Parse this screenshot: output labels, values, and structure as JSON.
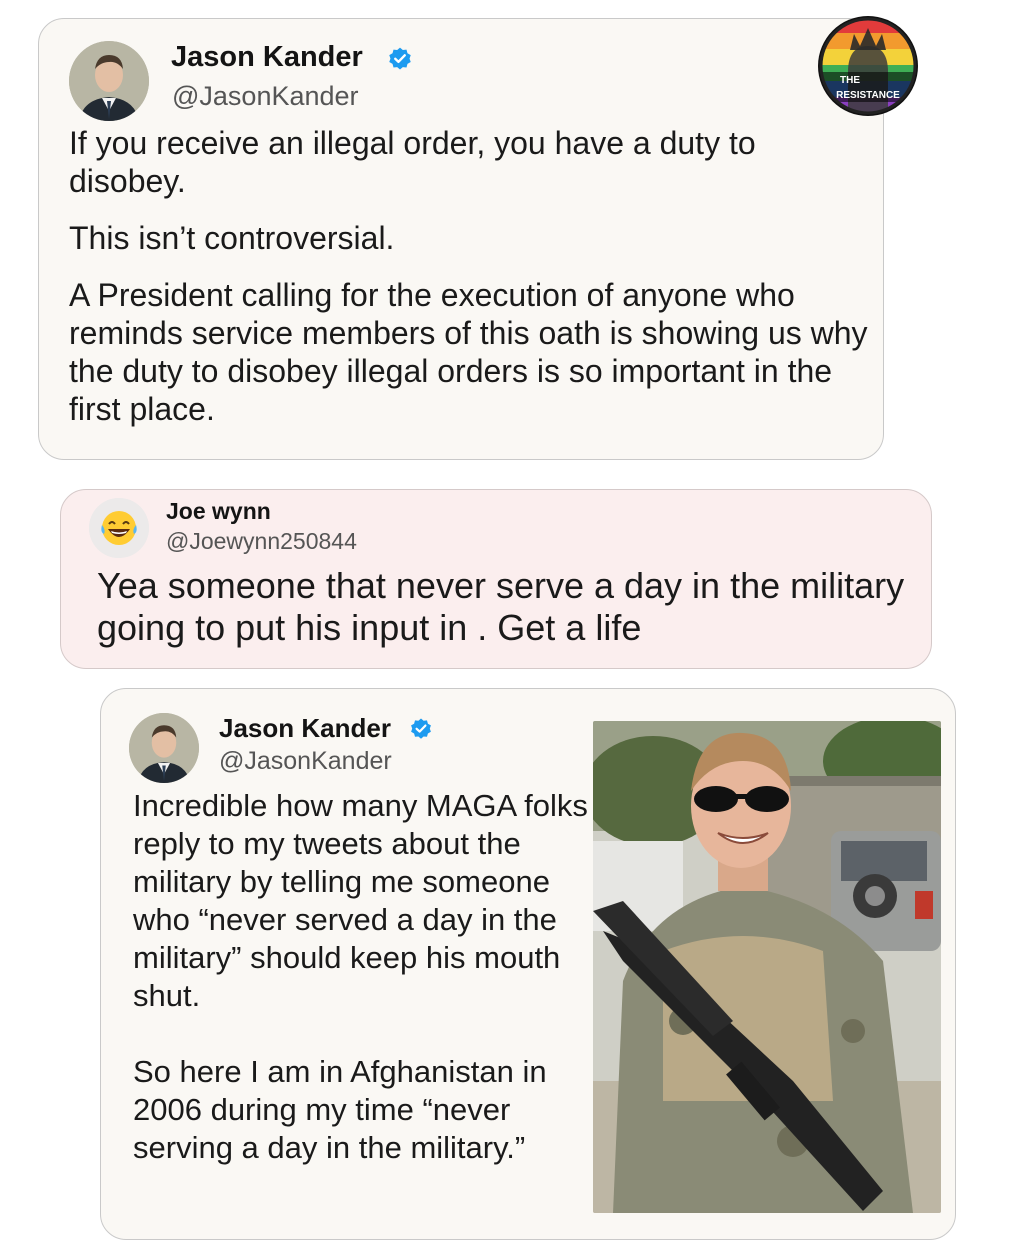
{
  "tweet1": {
    "author_name": "Jason Kander",
    "author_handle": "@JasonKander",
    "paragraph1": "If you receive an illegal order, you have a duty to disobey.",
    "paragraph2": "This isn’t controversial.",
    "paragraph3": "A President calling for the execution of anyone who reminds service members of this oath is showing us why the duty to disobey illegal orders is so important in the first place."
  },
  "badge": {
    "line1": "THE",
    "line2": "RESISTANCE"
  },
  "reply": {
    "author_name": "Joe wynn",
    "author_handle": "@Joewynn250844",
    "text": "Yea someone that never serve a day in the military going to put his input in . Get a life",
    "avatar_icon": "laughing-emoji-icon"
  },
  "tweet2": {
    "author_name": "Jason Kander",
    "author_handle": "@JasonKander",
    "paragraph1": "Incredible how many MAGA folks reply to my tweets about the military by telling me someone who “never served a day in the military” should keep his mouth shut.",
    "paragraph2": "So here I am in Afghanistan in 2006 during my time “never serving a day in the military.”"
  },
  "colors": {
    "verified_blue": "#1d9bf0",
    "tweet_card_bg": "#faf8f4",
    "reply_card_bg": "#fbeeee"
  }
}
